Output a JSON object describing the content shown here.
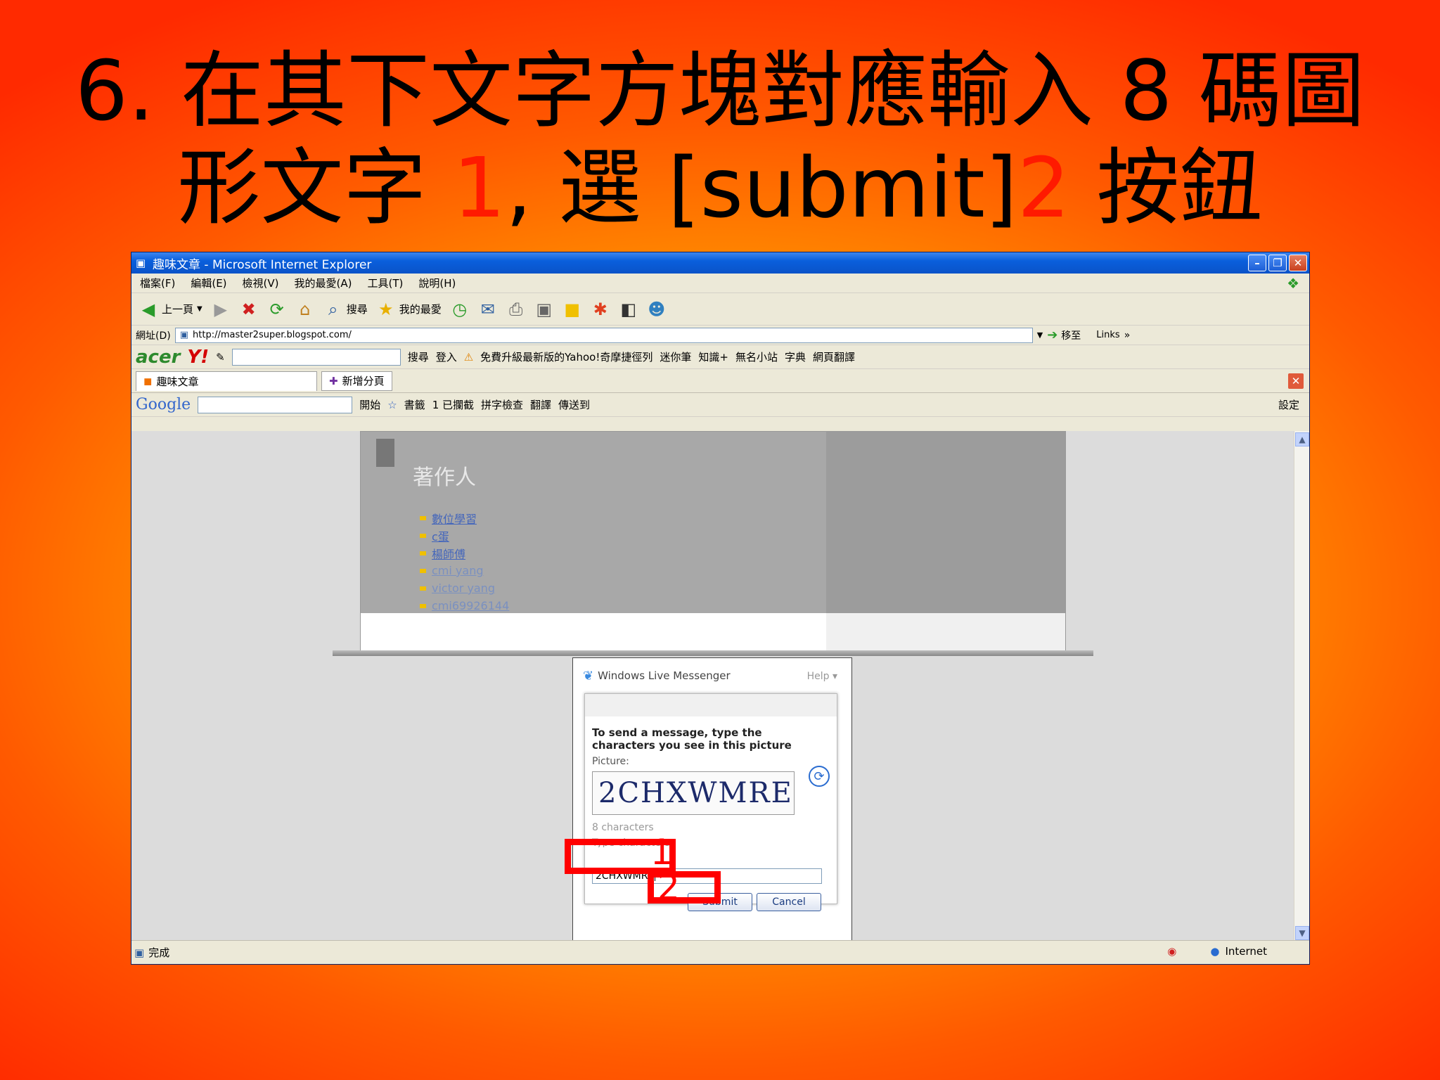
{
  "slide": {
    "title_line1": "6. 在其下文字方塊對應輸入 8 碼圖",
    "title_line2_a": "形文字 ",
    "title_line2_num1": "1",
    "title_line2_b": ", 選 [submit]",
    "title_line2_num2": "2",
    "title_line2_c": " 按鈕"
  },
  "window": {
    "title": "趣味文章 - Microsoft Internet Explorer"
  },
  "menu": [
    "檔案(F)",
    "編輯(E)",
    "檢視(V)",
    "我的最愛(A)",
    "工具(T)",
    "說明(H)"
  ],
  "toolbar": {
    "back": "上一頁",
    "search": "搜尋",
    "favorites": "我的最愛"
  },
  "address": {
    "label": "網址(D)",
    "url": "http://master2super.blogspot.com/",
    "go": "移至",
    "links": "Links"
  },
  "yahoo_toolbar": {
    "search": "搜尋",
    "login": "登入",
    "upgrade": "免費升級最新版的Yahoo!奇摩捷徑列",
    "mini": "迷你筆",
    "knowledge": "知識+",
    "station": "無名小站",
    "dict": "字典",
    "translate": "網頁翻譯"
  },
  "tabs": {
    "active": "趣味文章",
    "new_tab": "新增分頁"
  },
  "google_toolbar": {
    "logo": "Google",
    "start": "開始",
    "bookmarks": "書籤",
    "blocked": "1 已攔截",
    "spell": "拼字檢查",
    "translate": "翻譯",
    "send": "傳送到",
    "settings": "設定"
  },
  "blog": {
    "heading": "著作人",
    "authors": [
      "數位學習",
      "c蛋",
      "楊師傅",
      "cmi yang",
      "victor yang",
      "cmi69926144"
    ]
  },
  "messenger": {
    "brand": "Windows Live Messenger",
    "help": "Help",
    "instruction": "To send a message, type the characters you see in this picture",
    "picture_label": "Picture:",
    "captcha_text": "2CHXWMRE",
    "char_count": "8 characters",
    "type_label": "Type characters:",
    "input_value": "2CHXWMRE",
    "submit": "Submit",
    "cancel": "Cancel"
  },
  "annotations": {
    "mark1": "1",
    "mark2": "2"
  },
  "status": {
    "done": "完成",
    "zone": "Internet"
  }
}
